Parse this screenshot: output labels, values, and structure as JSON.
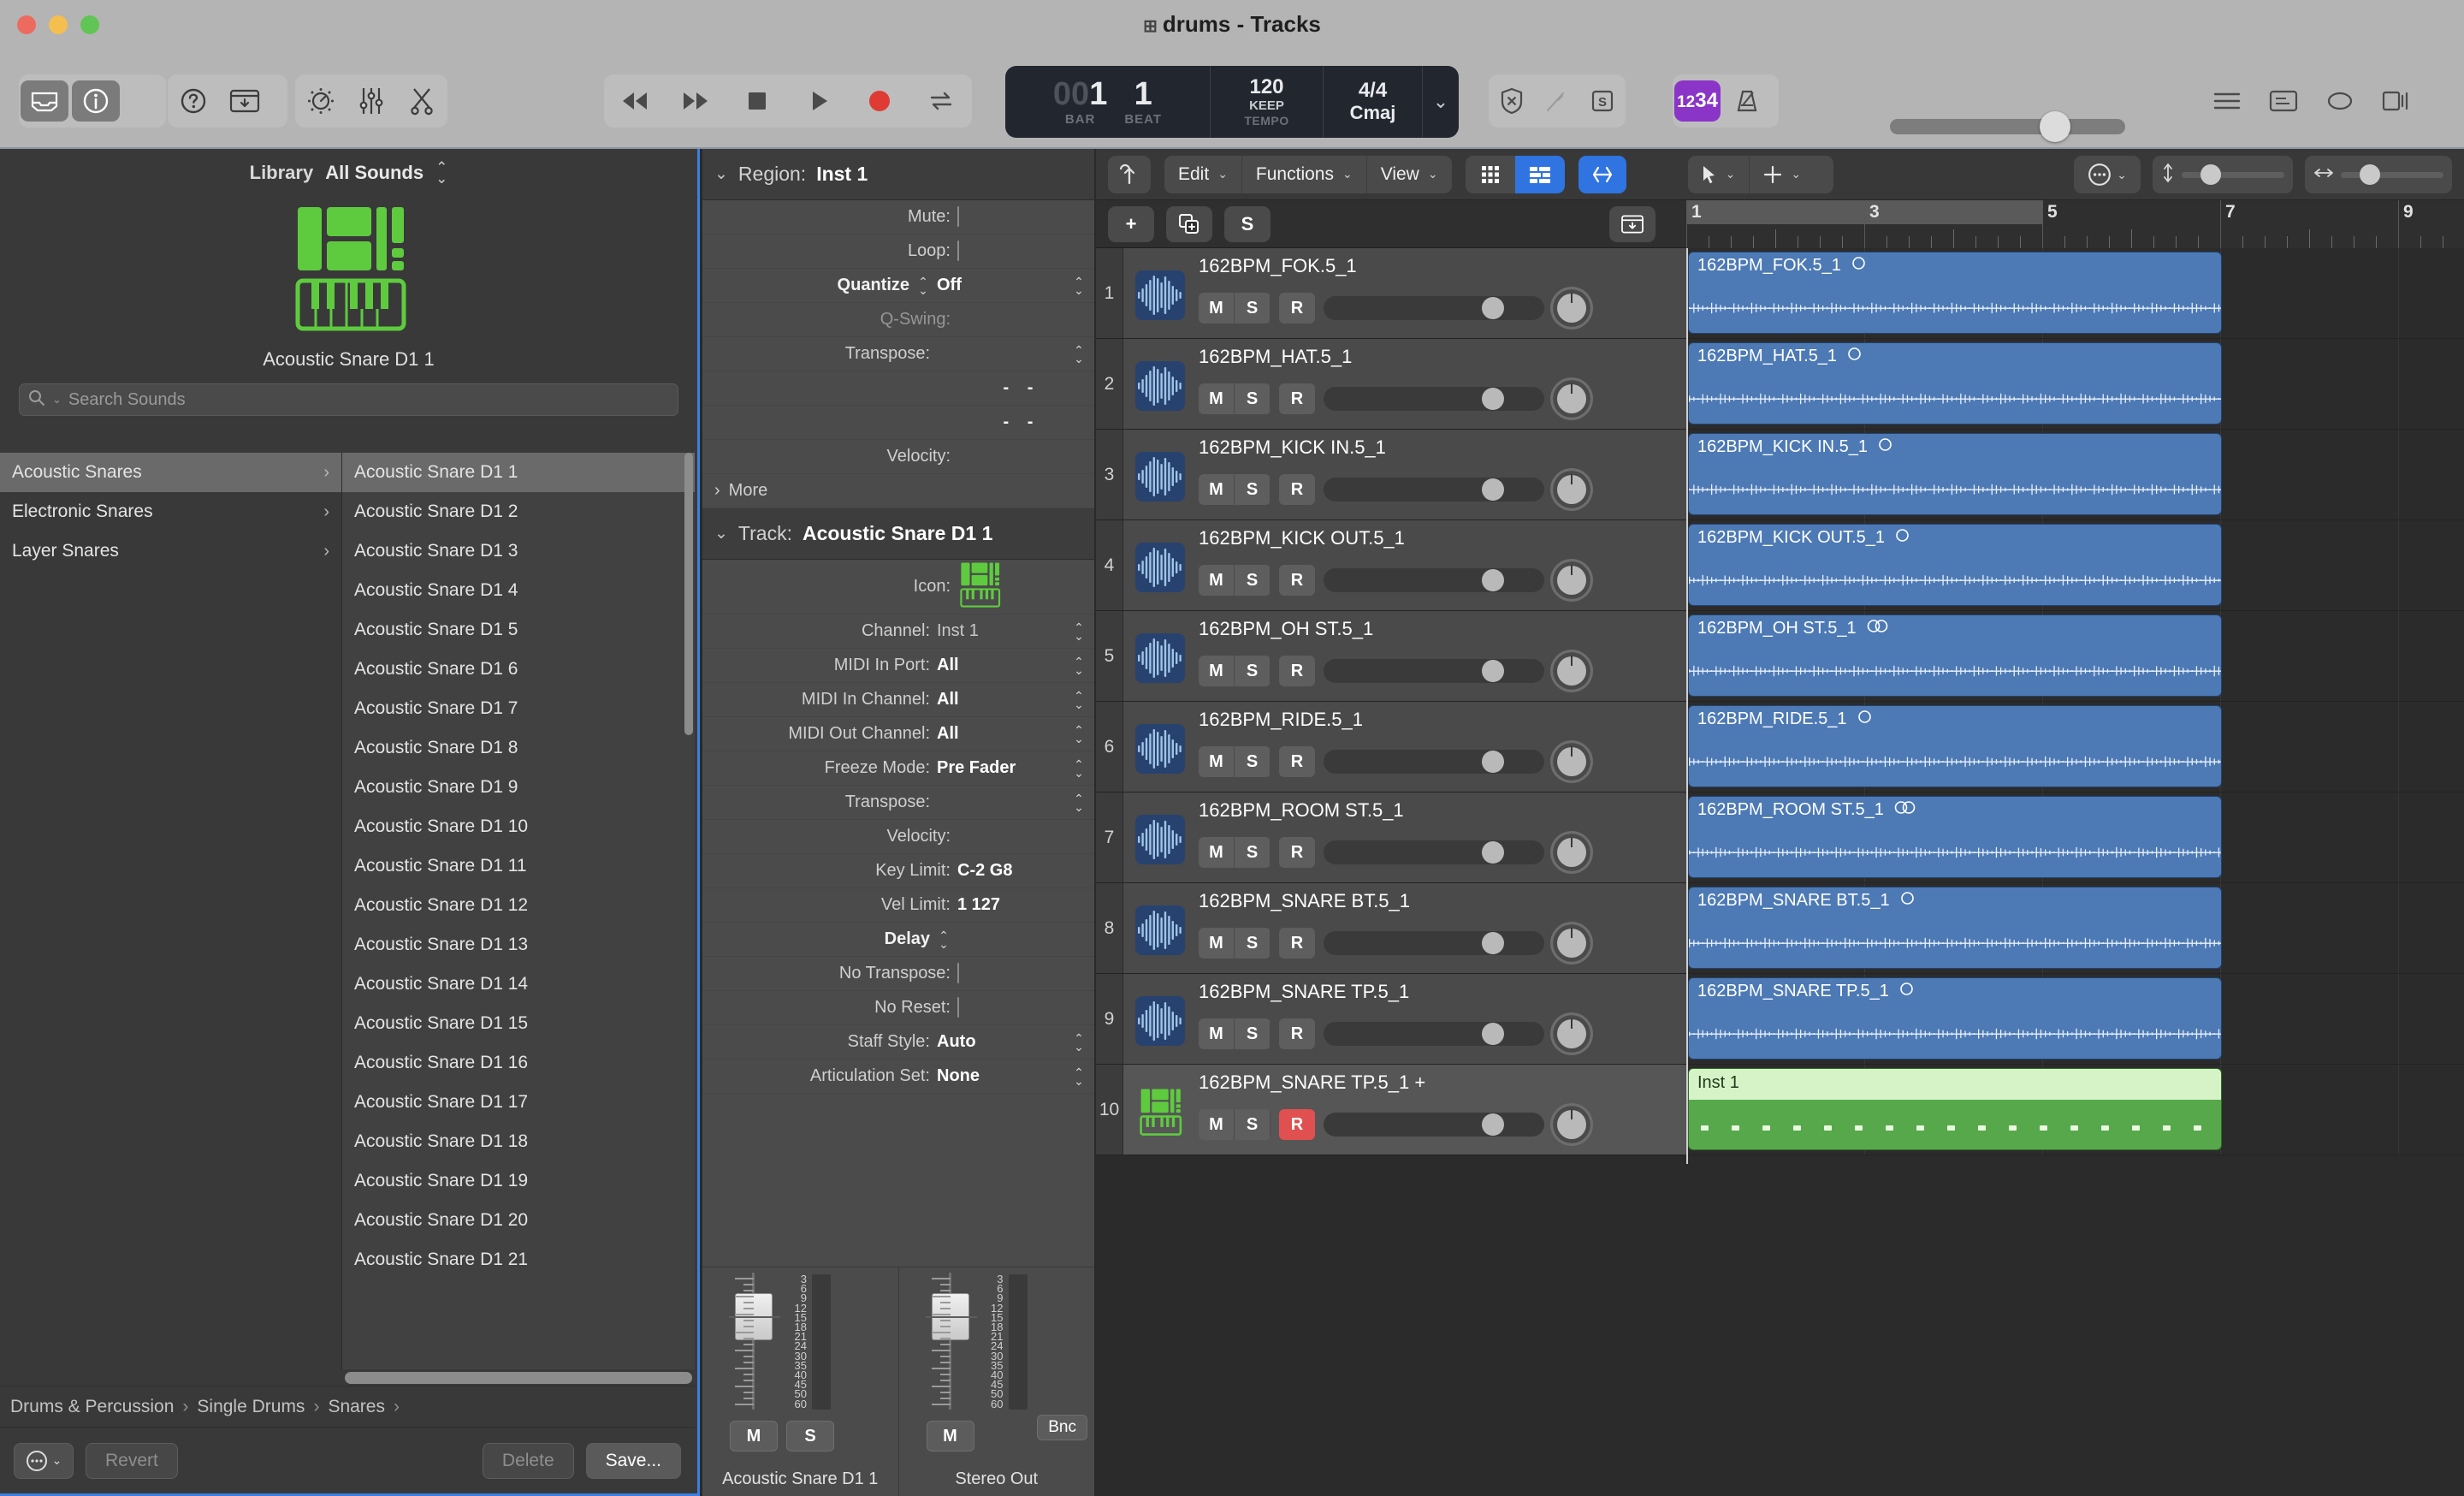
{
  "window": {
    "title": "drums - Tracks",
    "title_icon": "grid-icon"
  },
  "toolbar": {
    "left_buttons": [
      {
        "name": "library-toggle",
        "icon": "library-icon",
        "active": true
      },
      {
        "name": "inspector-toggle",
        "icon": "info-icon",
        "active": true
      },
      {
        "name": "quick-help",
        "icon": "question-icon",
        "active": false
      },
      {
        "name": "toolbar-toggle",
        "icon": "window-down-icon",
        "active": false
      }
    ],
    "tool_buttons": [
      {
        "name": "smart-controls",
        "icon": "knob-icon"
      },
      {
        "name": "mixer",
        "icon": "sliders-icon"
      },
      {
        "name": "editors",
        "icon": "scissors-icon"
      }
    ],
    "transport": [
      {
        "name": "rewind",
        "icon": "rewind-icon"
      },
      {
        "name": "forward",
        "icon": "forward-icon"
      },
      {
        "name": "stop",
        "icon": "stop-icon"
      },
      {
        "name": "play",
        "icon": "play-icon"
      },
      {
        "name": "record",
        "icon": "record-icon"
      },
      {
        "name": "cycle",
        "icon": "cycle-icon"
      }
    ],
    "lcd": {
      "bar_dim": "00",
      "bar": "1",
      "bar_label": "BAR",
      "beat": "1",
      "beat_label": "BEAT",
      "tempo": "120",
      "tempo_mode": "KEEP",
      "tempo_label": "TEMPO",
      "time_signature": "4/4",
      "key": "Cmaj",
      "chevron": "chevron-down-icon"
    },
    "mode_buttons": [
      {
        "name": "low-latency-mode",
        "icon": "shield-x-icon"
      },
      {
        "name": "midi-in",
        "icon": "midi-plug-icon"
      },
      {
        "name": "solo-mode",
        "icon": "s-box-icon"
      }
    ],
    "count_buttons": [
      {
        "name": "count-in",
        "label_small": "12",
        "label_big": "34",
        "accent": "#8a34c8"
      },
      {
        "name": "metronome",
        "icon": "metronome-icon"
      }
    ],
    "master_volume": {
      "name": "master-volume-slider",
      "value_pct": 64
    },
    "panel_buttons": [
      {
        "name": "list-editors",
        "icon": "list-icon"
      },
      {
        "name": "notepad",
        "icon": "notes-icon"
      },
      {
        "name": "loop-browser",
        "icon": "loop-icon"
      },
      {
        "name": "media-browser",
        "icon": "media-icon"
      }
    ]
  },
  "library": {
    "header_label": "Library",
    "filter_value": "All Sounds",
    "hero_name": "Acoustic Snare D1 1",
    "hero_icon": "drum-keyboard-icon",
    "search_placeholder": "Search Sounds",
    "search_icon": "search-icon",
    "categories": [
      {
        "label": "Acoustic Snares",
        "selected": true
      },
      {
        "label": "Electronic Snares",
        "selected": false
      },
      {
        "label": "Layer Snares",
        "selected": false
      }
    ],
    "patches": [
      {
        "label": "Acoustic Snare D1 1",
        "selected": true
      },
      {
        "label": "Acoustic Snare D1 2",
        "selected": false
      },
      {
        "label": "Acoustic Snare D1 3",
        "selected": false
      },
      {
        "label": "Acoustic Snare D1 4",
        "selected": false
      },
      {
        "label": "Acoustic Snare D1 5",
        "selected": false
      },
      {
        "label": "Acoustic Snare D1 6",
        "selected": false
      },
      {
        "label": "Acoustic Snare D1 7",
        "selected": false
      },
      {
        "label": "Acoustic Snare D1 8",
        "selected": false
      },
      {
        "label": "Acoustic Snare D1 9",
        "selected": false
      },
      {
        "label": "Acoustic Snare D1 10",
        "selected": false
      },
      {
        "label": "Acoustic Snare D1 11",
        "selected": false
      },
      {
        "label": "Acoustic Snare D1 12",
        "selected": false
      },
      {
        "label": "Acoustic Snare D1 13",
        "selected": false
      },
      {
        "label": "Acoustic Snare D1 14",
        "selected": false
      },
      {
        "label": "Acoustic Snare D1 15",
        "selected": false
      },
      {
        "label": "Acoustic Snare D1 16",
        "selected": false
      },
      {
        "label": "Acoustic Snare D1 17",
        "selected": false
      },
      {
        "label": "Acoustic Snare D1 18",
        "selected": false
      },
      {
        "label": "Acoustic Snare D1 19",
        "selected": false
      },
      {
        "label": "Acoustic Snare D1 20",
        "selected": false
      },
      {
        "label": "Acoustic Snare D1 21",
        "selected": false
      }
    ],
    "breadcrumbs": [
      "Drums & Percussion",
      "Single Drums",
      "Snares"
    ],
    "breadcrumb_sep": "›",
    "footer": {
      "more_icon": "more-circle-icon",
      "revert_label": "Revert",
      "delete_label": "Delete",
      "save_label": "Save..."
    }
  },
  "inspector": {
    "region": {
      "header_label": "Region:",
      "header_value": "Inst 1",
      "rows": [
        {
          "key": "Mute:",
          "type": "checkbox",
          "value": ""
        },
        {
          "key": "Loop:",
          "type": "checkbox",
          "value": ""
        },
        {
          "key": "Quantize",
          "type": "stepper-value",
          "value": "Off",
          "key_bold": true
        },
        {
          "key": "Q-Swing:",
          "type": "empty",
          "value": "",
          "dim": true
        },
        {
          "key": "Transpose:",
          "type": "stepper",
          "value": ""
        },
        {
          "key": "",
          "type": "dashes",
          "value": "- -"
        },
        {
          "key": "",
          "type": "dashes",
          "value": "- -"
        },
        {
          "key": "Velocity:",
          "type": "empty",
          "value": ""
        }
      ],
      "more_label": "More"
    },
    "track": {
      "header_label": "Track:",
      "header_value": "Acoustic Snare D1 1",
      "icon_label": "Icon:",
      "icon_name": "drum-keyboard-icon",
      "rows": [
        {
          "key": "Channel:",
          "value": "Inst 1",
          "dim": true,
          "stepper": true
        },
        {
          "key": "MIDI In Port:",
          "value": "All",
          "stepper": true
        },
        {
          "key": "MIDI In Channel:",
          "value": "All",
          "stepper": true
        },
        {
          "key": "MIDI Out Channel:",
          "value": "All",
          "stepper": true
        },
        {
          "key": "Freeze Mode:",
          "value": "Pre Fader",
          "stepper": true
        },
        {
          "key": "Transpose:",
          "value": "",
          "stepper": true
        },
        {
          "key": "Velocity:",
          "value": "",
          "stepper": false
        },
        {
          "key": "Key Limit:",
          "value": "C-2  G8",
          "stepper": false
        },
        {
          "key": "Vel Limit:",
          "value": "1  127",
          "stepper": false
        },
        {
          "key": "Delay",
          "value": "",
          "stepper": true,
          "key_bold": true
        },
        {
          "key": "No Transpose:",
          "value": "",
          "checkbox": true
        },
        {
          "key": "No Reset:",
          "value": "",
          "checkbox": true
        },
        {
          "key": "Staff Style:",
          "value": "Auto",
          "stepper": true
        },
        {
          "key": "Articulation Set:",
          "value": "None",
          "stepper": true
        }
      ]
    },
    "strips": [
      {
        "name": "Acoustic Snare D1 1",
        "buttons": [
          "M",
          "S"
        ],
        "bounce": null,
        "scale": [
          "3",
          "6",
          "9",
          "12",
          "15",
          "18",
          "21",
          "24",
          "30",
          "35",
          "40",
          "45",
          "50",
          "60"
        ]
      },
      {
        "name": "Stereo Out",
        "buttons": [
          "M"
        ],
        "bounce": "Bnc",
        "scale": [
          "3",
          "6",
          "9",
          "12",
          "15",
          "18",
          "21",
          "24",
          "30",
          "35",
          "40",
          "45",
          "50",
          "60"
        ]
      }
    ]
  },
  "tracks_area": {
    "nav_up_icon": "arrow-up-icon",
    "menus": [
      {
        "label": "Edit"
      },
      {
        "label": "Functions"
      },
      {
        "label": "View"
      }
    ],
    "view_toggle": [
      {
        "name": "grid-view",
        "icon": "grid-icon",
        "active": false
      },
      {
        "name": "list-view",
        "icon": "list-rows-icon",
        "active": true
      }
    ],
    "flex_button": {
      "name": "flex-button",
      "icon": "flex-icon",
      "active": true
    },
    "tool_selectors": [
      {
        "name": "pointer-tool",
        "icon": "pointer-icon"
      },
      {
        "name": "secondary-tool",
        "icon": "crosshair-icon"
      }
    ],
    "right_controls": {
      "catch_icon": "more-circle-icon",
      "vertical_zoom": {
        "name": "vertical-zoom-slider",
        "icon": "vertical-arrows-icon",
        "value_pct": 22
      },
      "horizontal_zoom": {
        "name": "horizontal-zoom-slider",
        "icon": "horizontal-arrows-icon",
        "value_pct": 22
      }
    },
    "subbar": [
      {
        "name": "add-track-button",
        "label": "+"
      },
      {
        "name": "duplicate-track-button",
        "icon": "duplicate-icon"
      },
      {
        "name": "solo-button",
        "label": "S"
      }
    ],
    "auto_track_zoom": {
      "name": "auto-track-zoom-button",
      "icon": "window-down-icon"
    },
    "ruler": {
      "bars": [
        "1",
        "3",
        "5",
        "7",
        "9"
      ],
      "cycle_start_bar": 1,
      "cycle_end_bar": 5
    },
    "playhead_bar": "1",
    "tracks": [
      {
        "num": "1",
        "name": "162BPM_FOK.5_1",
        "icon": "waveform-icon",
        "rec": false,
        "selected": false,
        "region": {
          "name": "162BPM_FOK.5_1",
          "type": "audio",
          "channels": "mono"
        }
      },
      {
        "num": "2",
        "name": "162BPM_HAT.5_1",
        "icon": "waveform-icon",
        "rec": false,
        "selected": false,
        "region": {
          "name": "162BPM_HAT.5_1",
          "type": "audio",
          "channels": "mono"
        }
      },
      {
        "num": "3",
        "name": "162BPM_KICK IN.5_1",
        "icon": "waveform-icon",
        "rec": false,
        "selected": false,
        "region": {
          "name": "162BPM_KICK IN.5_1",
          "type": "audio",
          "channels": "mono"
        }
      },
      {
        "num": "4",
        "name": "162BPM_KICK OUT.5_1",
        "icon": "waveform-icon",
        "rec": false,
        "selected": false,
        "region": {
          "name": "162BPM_KICK OUT.5_1",
          "type": "audio",
          "channels": "mono"
        }
      },
      {
        "num": "5",
        "name": "162BPM_OH ST.5_1",
        "icon": "waveform-icon",
        "rec": false,
        "selected": false,
        "region": {
          "name": "162BPM_OH ST.5_1",
          "type": "audio",
          "channels": "stereo"
        }
      },
      {
        "num": "6",
        "name": "162BPM_RIDE.5_1",
        "icon": "waveform-icon",
        "rec": false,
        "selected": false,
        "region": {
          "name": "162BPM_RIDE.5_1",
          "type": "audio",
          "channels": "mono"
        }
      },
      {
        "num": "7",
        "name": "162BPM_ROOM ST.5_1",
        "icon": "waveform-icon",
        "rec": false,
        "selected": false,
        "region": {
          "name": "162BPM_ROOM ST.5_1",
          "type": "audio",
          "channels": "stereo"
        }
      },
      {
        "num": "8",
        "name": "162BPM_SNARE BT.5_1",
        "icon": "waveform-icon",
        "rec": false,
        "selected": false,
        "region": {
          "name": "162BPM_SNARE BT.5_1",
          "type": "audio",
          "channels": "mono"
        }
      },
      {
        "num": "9",
        "name": "162BPM_SNARE TP.5_1",
        "icon": "waveform-icon",
        "rec": false,
        "selected": false,
        "region": {
          "name": "162BPM_SNARE TP.5_1",
          "type": "audio",
          "channels": "mono"
        }
      },
      {
        "num": "10",
        "name": "162BPM_SNARE TP.5_1 +",
        "icon": "drum-keyboard-icon",
        "rec": true,
        "selected": true,
        "region": {
          "name": "Inst 1",
          "type": "midi",
          "channels": ""
        }
      }
    ]
  },
  "colors": {
    "accent_blue": "#2f74e0",
    "audio_region": "#4d7ab5",
    "midi_region": "#57a84b",
    "record_red": "#e05050",
    "count_purple": "#8a34c8",
    "library_green": "#5ecb3f"
  }
}
